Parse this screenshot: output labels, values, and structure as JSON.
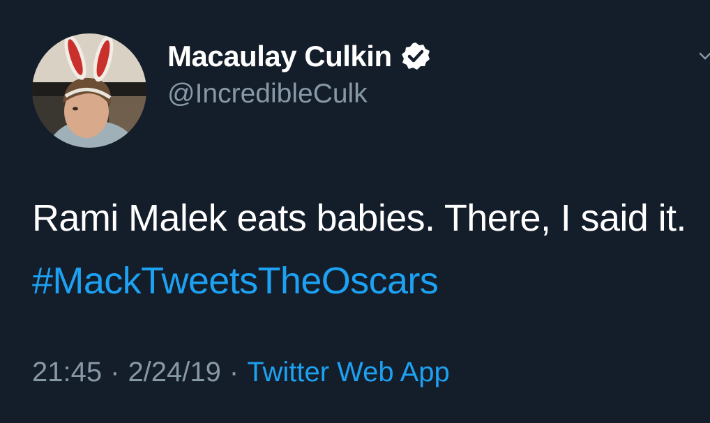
{
  "user": {
    "display_name": "Macaulay Culkin",
    "handle": "@IncredibleCulk",
    "verified": true,
    "avatar_icon": "profile-photo-bunny-ears"
  },
  "tweet": {
    "text_before": "Rami Malek eats babies. There, I said it. ",
    "hashtag": "#MackTweetsTheOscars"
  },
  "meta": {
    "time": "21:45",
    "separator": "·",
    "date": "2/24/19",
    "source": "Twitter Web App"
  },
  "colors": {
    "background": "#141d2a",
    "accent": "#1da1f2",
    "secondary_text": "#8899a6"
  }
}
